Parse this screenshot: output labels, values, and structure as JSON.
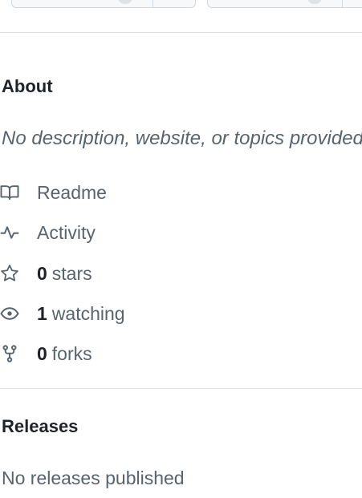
{
  "about": {
    "title": "About",
    "description": "No description, website, or topics provided."
  },
  "meta": {
    "readme": "Readme",
    "activity": "Activity",
    "stars_count": "0",
    "stars_label": "stars",
    "watching_count": "1",
    "watching_label": "watching",
    "forks_count": "0",
    "forks_label": "forks"
  },
  "releases": {
    "title": "Releases",
    "empty_text": "No releases published"
  },
  "icons": {
    "readme": "book-icon",
    "activity": "pulse-icon",
    "stars": "star-icon",
    "watching": "eye-icon",
    "forks": "fork-icon"
  },
  "colors": {
    "text_primary": "#1f2328",
    "text_muted": "#59636e",
    "border": "#d8dee4"
  }
}
